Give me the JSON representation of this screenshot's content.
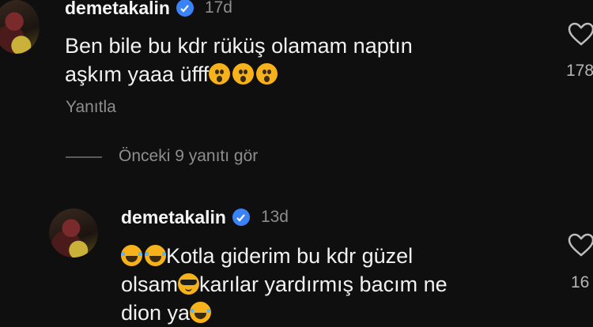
{
  "comments": [
    {
      "username": "demetakalin",
      "time": "17d",
      "text_line1": "Ben bile bu kdr rüküş olamam naptın",
      "text_line2": "aşkım yaaa üfff",
      "emojis_line2": [
        "astonished-face",
        "astonished-face",
        "astonished-face"
      ],
      "reply_label": "Yanıtla",
      "like_count": "178"
    },
    {
      "username": "demetakalin",
      "time": "13d",
      "emojis_line1": [
        "tears-of-joy-face",
        "tears-of-joy-face"
      ],
      "text_line1": "Kotla giderim bu kdr güzel",
      "text_line2a": "olsam",
      "emoji_line2": "sunglasses-face",
      "text_line2b": "karılar yardırmış bacım ne",
      "text_line3": "dion ya",
      "emoji_line3": "tears-of-joy-face",
      "like_count": "16"
    }
  ],
  "view_replies": "Önceki 9 yanıtı gör",
  "colors": {
    "background": "#0f0f10",
    "verified": "#3b82f6",
    "muted": "#8e8e8e"
  }
}
